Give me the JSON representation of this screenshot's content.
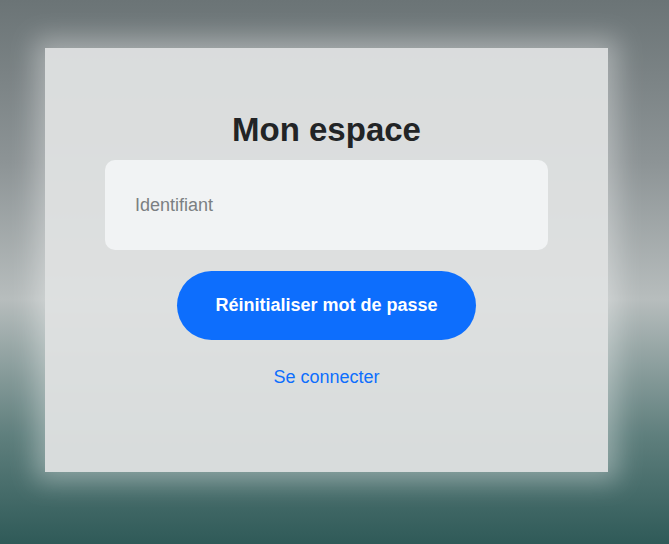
{
  "card": {
    "title": "Mon espace",
    "login": {
      "placeholder": "Identifiant"
    },
    "submit": "Réinitialiser mot de passe",
    "link": "Se connecter"
  }
}
